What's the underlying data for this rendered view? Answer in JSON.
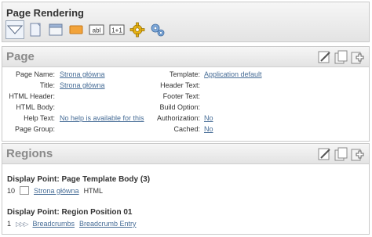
{
  "page_rendering": {
    "title": "Page Rendering",
    "toolbar": [
      {
        "icon": "page-collapse-icon"
      },
      {
        "icon": "page-document-icon"
      },
      {
        "icon": "region-window-icon"
      },
      {
        "icon": "button-orange-icon"
      },
      {
        "icon": "item-text-field-icon",
        "text": "abl"
      },
      {
        "icon": "computation-icon",
        "text": "1+1"
      },
      {
        "icon": "process-gear-icon"
      },
      {
        "icon": "shared-components-gears-icon"
      }
    ]
  },
  "page": {
    "title": "Page",
    "left": [
      {
        "label": "Page Name:",
        "value": "Strona główna",
        "link": true
      },
      {
        "label": "Title:",
        "value": "Strona główna",
        "link": true
      },
      {
        "label": "HTML Header:",
        "value": "",
        "link": false
      },
      {
        "label": "HTML Body:",
        "value": "",
        "link": false
      },
      {
        "label": "Help Text:",
        "value": "No help is available for this",
        "link": true
      },
      {
        "label": "Page Group:",
        "value": "",
        "link": false
      }
    ],
    "right": [
      {
        "label": "Template:",
        "value": "Application default",
        "link": true
      },
      {
        "label": "Header Text:",
        "value": "",
        "link": false
      },
      {
        "label": "Footer Text:",
        "value": "",
        "link": false
      },
      {
        "label": "Build Option:",
        "value": "",
        "link": false
      },
      {
        "label": "Authorization:",
        "value": "No",
        "link": true
      },
      {
        "label": "Cached:",
        "value": "No",
        "link": true
      }
    ]
  },
  "regions": {
    "title": "Regions",
    "groups": [
      {
        "heading": "Display Point: Page Template Body (3)",
        "rows": [
          {
            "seq": "10",
            "name": "Strona główna",
            "type": "HTML"
          }
        ]
      },
      {
        "heading": "Display Point: Region Position 01",
        "rows": [
          {
            "seq": "1",
            "name": "Breadcrumbs",
            "type": "Breadcrumb Entry"
          }
        ]
      }
    ]
  }
}
